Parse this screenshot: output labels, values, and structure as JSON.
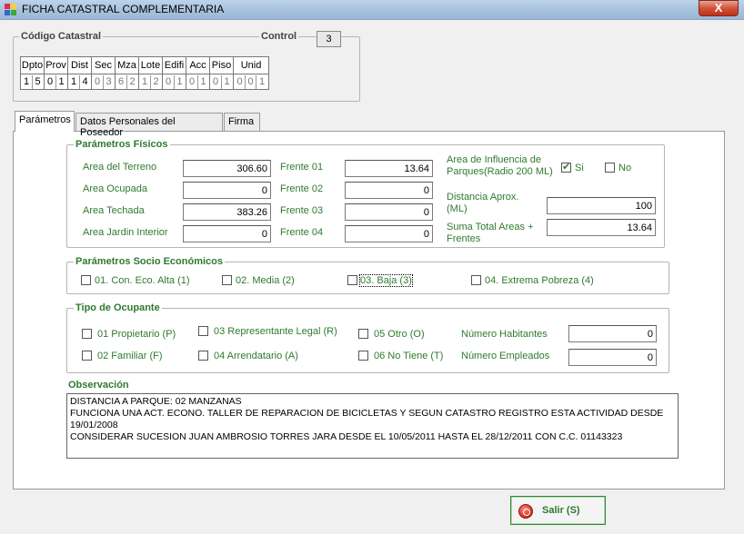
{
  "window": {
    "title": "FICHA CATASTRAL COMPLEMENTARIA",
    "close_label": "X"
  },
  "codigo": {
    "legend": "Código Catastral",
    "control_label": "Control",
    "control_value": "3",
    "columns": [
      {
        "header": "Dpto",
        "digits": [
          "1",
          "5"
        ]
      },
      {
        "header": "Prov",
        "digits": [
          "0",
          "1"
        ]
      },
      {
        "header": "Dist",
        "digits": [
          "1",
          "4"
        ]
      },
      {
        "header": "Sec",
        "digits": [
          "0",
          "3"
        ]
      },
      {
        "header": "Mza",
        "digits": [
          "6",
          "2"
        ]
      },
      {
        "header": "Lote",
        "digits": [
          "1",
          "2"
        ]
      },
      {
        "header": "Edifi",
        "digits": [
          "0",
          "1"
        ]
      },
      {
        "header": "Acc",
        "digits": [
          "0",
          "1"
        ]
      },
      {
        "header": "Piso",
        "digits": [
          "0",
          "1"
        ]
      },
      {
        "header": "Unid",
        "digits": [
          "0",
          "0",
          "1"
        ]
      }
    ]
  },
  "tabs": [
    "Parámetros",
    "Datos Personales del Poseedor",
    "Firma"
  ],
  "fisicos": {
    "legend": "Parámetros Físicos",
    "area_terreno_label": "Area del Terreno",
    "area_terreno": "306.60",
    "area_ocupada_label": "Area Ocupada",
    "area_ocupada": "0",
    "area_techada_label": "Area Techada",
    "area_techada": "383.26",
    "area_jardin_label": "Area Jardin Interior",
    "area_jardin": "0",
    "frente01_label": "Frente 01",
    "frente01": "13.64",
    "frente02_label": "Frente 02",
    "frente02": "0",
    "frente03_label": "Frente 03",
    "frente03": "0",
    "frente04_label": "Frente 04",
    "frente04": "0",
    "influencia_label_1": "Area de Influencia de",
    "influencia_label_2": "Parques(Radio 200 ML)",
    "si_label": "Si",
    "no_label": "No",
    "distancia_label_1": "Distancia Aprox.",
    "distancia_label_2": "(ML)",
    "distancia": "100",
    "suma_label_1": "Suma Total Areas +",
    "suma_label_2": "Frentes",
    "suma": "13.64"
  },
  "socio": {
    "legend": "Parámetros Socio Económicos",
    "options": [
      "01. Con. Eco. Alta (1)",
      "02. Media (2)",
      "03. Baja (3)",
      "04. Extrema Pobreza (4)"
    ]
  },
  "ocupante": {
    "legend": "Tipo de Ocupante",
    "options": [
      "01 Propietario (P)",
      "03 Representante Legal (R)",
      "05 Otro (O)",
      "02 Familiar (F)",
      "04 Arrendatario (A)",
      "06 No Tiene (T)"
    ],
    "habitantes_label": "Número Habitantes",
    "habitantes": "0",
    "empleados_label": "Número Empleados",
    "empleados": "0"
  },
  "observacion": {
    "label": "Observación",
    "lines": [
      "DISTANCIA A PARQUE: 02 MANZANAS",
      "FUNCIONA UNA ACT. ECONO. TALLER DE REPARACION DE BICICLETAS Y SEGUN CATASTRO REGISTRO ESTA ACTIVIDAD DESDE",
      "19/01/2008",
      "CONSIDERAR SUCESION JUAN AMBROSIO TORRES JARA DESDE EL 10/05/2011 HASTA EL 28/12/2011 CON C.C. 01143323"
    ]
  },
  "salir_label": "Salir (S)",
  "colors": {
    "accent_green": "#2f7a2f",
    "close_red": "#c0301a"
  }
}
